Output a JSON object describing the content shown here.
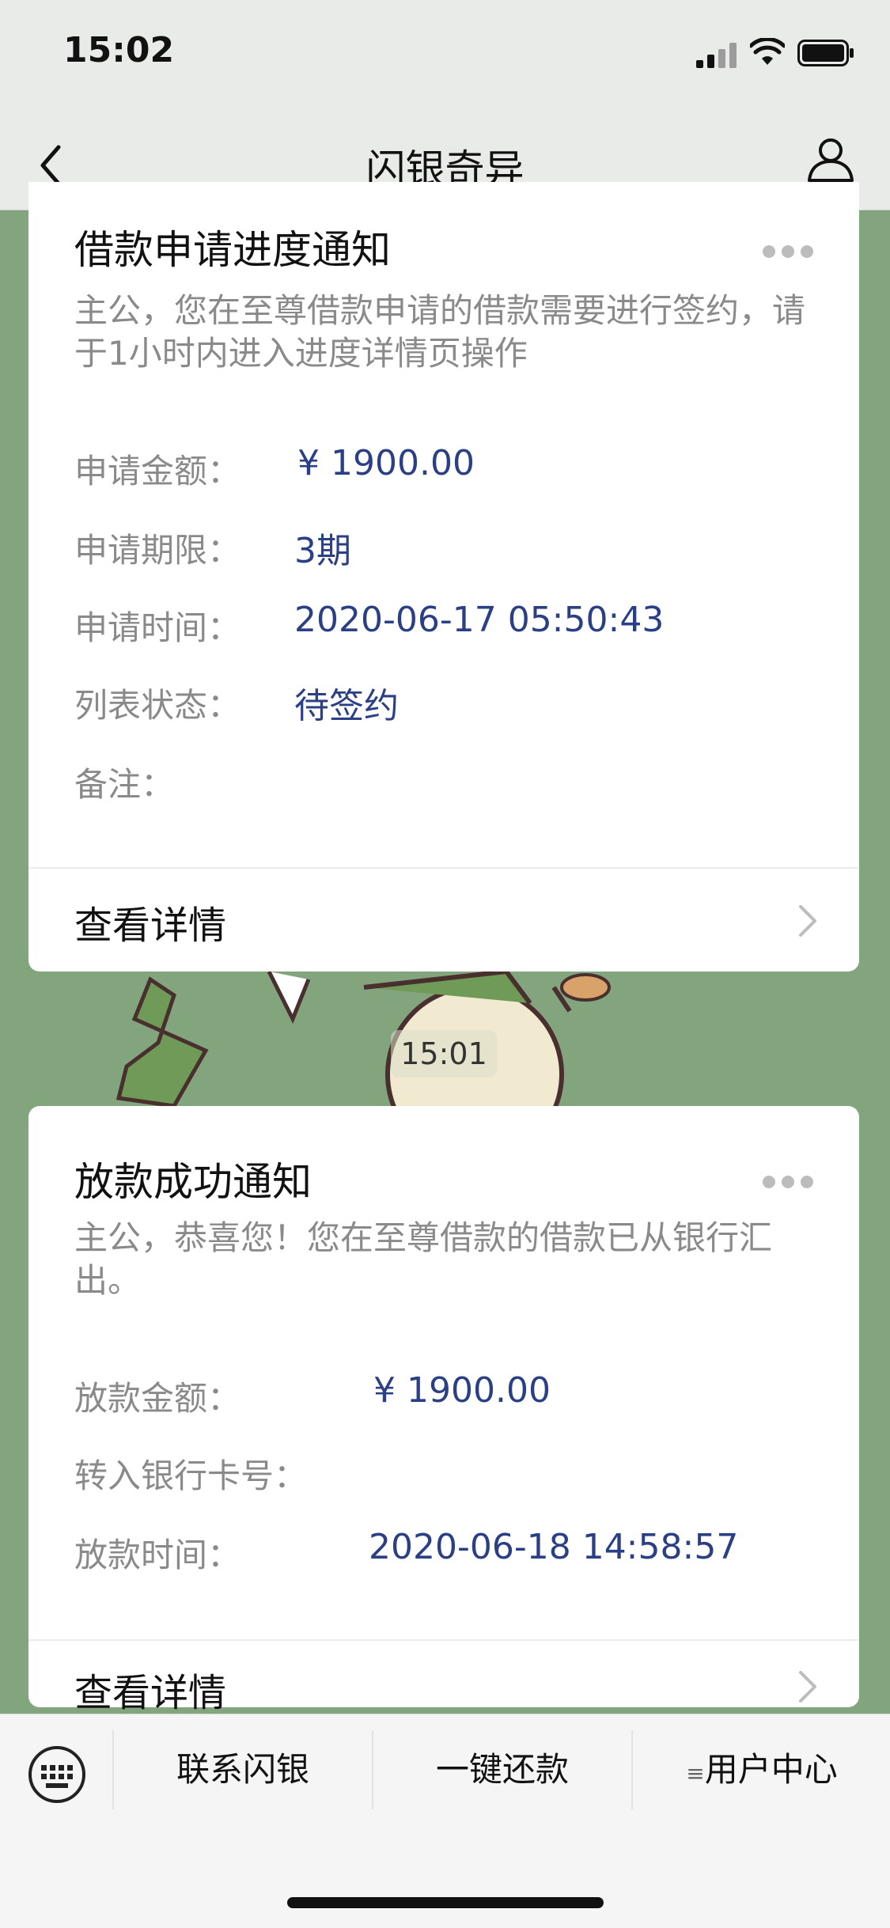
{
  "status_bar": {
    "time": "15:02"
  },
  "nav": {
    "title": "闪银奇异"
  },
  "card1": {
    "title": "借款申请进度通知",
    "description": "主公，您在至尊借款申请的借款需要进行签约，请于1小时内进入进度详情页操作",
    "rows": [
      {
        "label": "申请金额：",
        "value": "¥ 1900.00"
      },
      {
        "label": "申请期限：",
        "value": "3期"
      },
      {
        "label": "申请时间：",
        "value": "2020-06-17 05:50:43"
      },
      {
        "label": "列表状态：",
        "value": "待签约"
      },
      {
        "label": "备注：",
        "value": ""
      }
    ],
    "detail_link": "查看详情"
  },
  "timestamp": "15:01",
  "card2": {
    "title": "放款成功通知",
    "description": "主公，恭喜您！您在至尊借款的借款已从银行汇出。",
    "rows": [
      {
        "label": "放款金额：",
        "value": "¥ 1900.00"
      },
      {
        "label": "转入银行卡号：",
        "value": ""
      },
      {
        "label": "放款时间：",
        "value": "2020-06-18 14:58:57"
      }
    ],
    "detail_link": "查看详情"
  },
  "tabbar": {
    "tabs": [
      {
        "label": "联系闪银"
      },
      {
        "label": "一键还款"
      },
      {
        "label": "用户中心",
        "menu_prefix": "≡"
      }
    ]
  },
  "colors": {
    "background": "#82a57e",
    "accent_value": "#2b3f85",
    "muted_text": "#8a8a8a"
  }
}
